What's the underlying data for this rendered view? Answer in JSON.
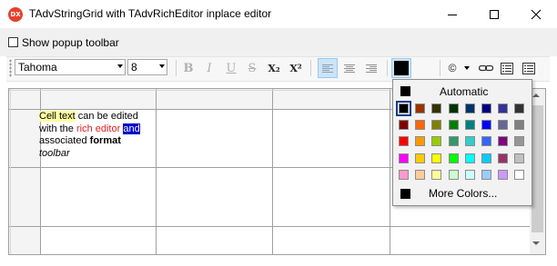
{
  "window": {
    "title": "TAdvStringGrid with TAdvRichEditor inplace editor",
    "app_icon_text": "DX",
    "controls": [
      "minimize",
      "maximize",
      "close"
    ]
  },
  "options": {
    "show_popup_toolbar_label": "Show popup toolbar",
    "show_popup_toolbar_checked": false
  },
  "toolbar": {
    "font_name": "Tahoma",
    "font_size": "8",
    "bold": "B",
    "italic": "I",
    "underline": "U",
    "strike": "S",
    "subscript": "X₂",
    "superscript": "X²",
    "symbol": "©",
    "font_color": "#000000",
    "active_button": "align-left"
  },
  "grid": {
    "cell_text": {
      "segments": [
        {
          "text": "Cell text",
          "style": "highlight-yellow"
        },
        {
          "text": " can be edited",
          "style": "normal"
        },
        {
          "text": "with the ",
          "style": "normal"
        },
        {
          "text": "rich editor",
          "style": "red"
        },
        {
          "text": "and",
          "style": "selected"
        },
        {
          "text": "associated ",
          "style": "normal"
        },
        {
          "text": "format",
          "style": "bold"
        },
        {
          "text": "toolbar",
          "style": "italic"
        }
      ]
    }
  },
  "color_popup": {
    "automatic_label": "Automatic",
    "more_colors_label": "More Colors...",
    "selected_color": "#000000",
    "palette": [
      [
        "#000000",
        "#993300",
        "#333300",
        "#003300",
        "#003366",
        "#000080",
        "#333399",
        "#333333"
      ],
      [
        "#800000",
        "#FF6600",
        "#808000",
        "#008000",
        "#008080",
        "#0000FF",
        "#666699",
        "#808080"
      ],
      [
        "#FF0000",
        "#FF9900",
        "#99CC00",
        "#339966",
        "#33CCCC",
        "#3366FF",
        "#800080",
        "#969696"
      ],
      [
        "#FF00FF",
        "#FFCC00",
        "#FFFF00",
        "#00FF00",
        "#00FFFF",
        "#00CCFF",
        "#993366",
        "#C0C0C0"
      ],
      [
        "#FF99CC",
        "#FFCC99",
        "#FFFF99",
        "#CCFFCC",
        "#CCFFFF",
        "#99CCFF",
        "#CC99FF",
        "#FFFFFF"
      ]
    ]
  }
}
